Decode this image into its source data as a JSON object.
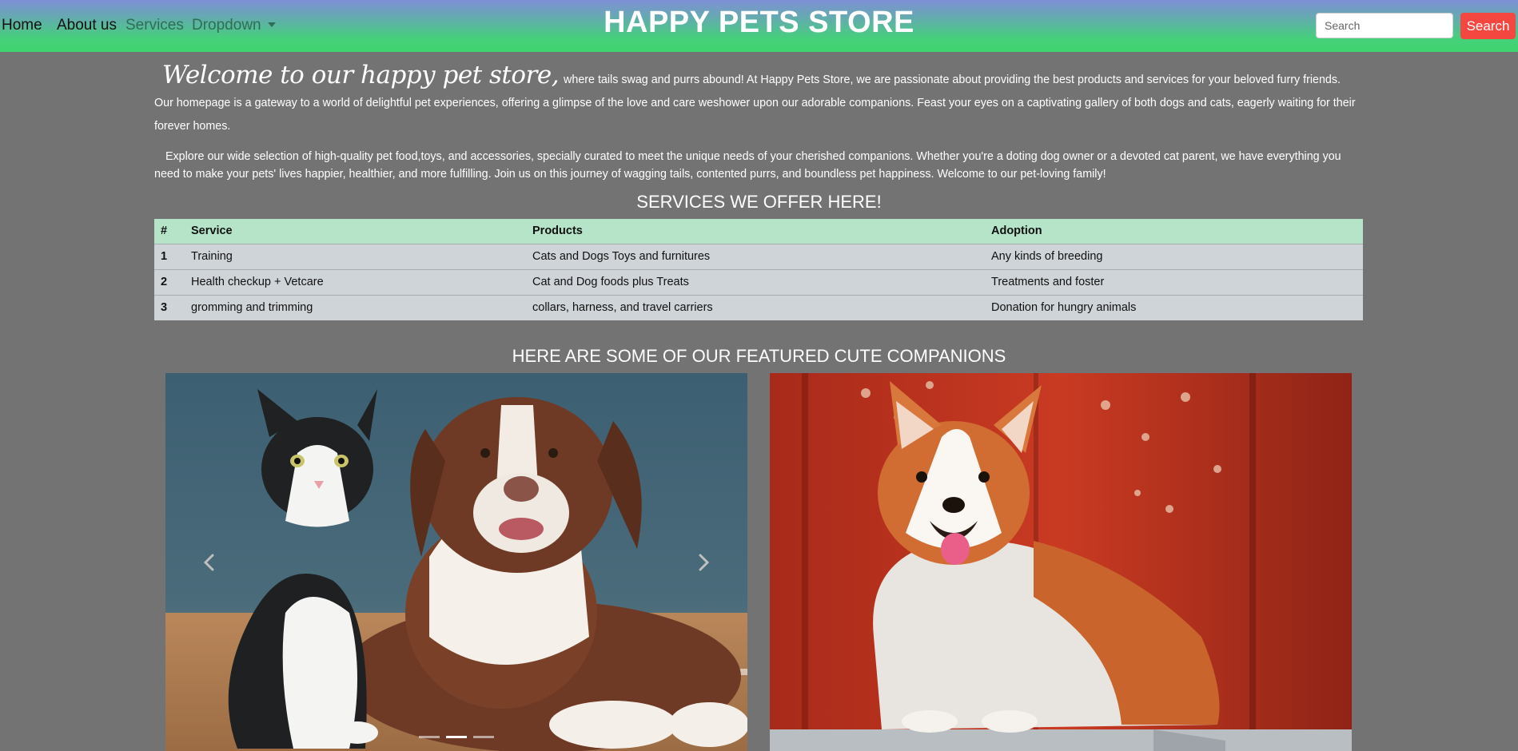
{
  "nav": {
    "home": "Home",
    "about": "About us",
    "services": "Services",
    "dropdown": "Dropdown",
    "brand": "HAPPY PETS STORE",
    "search_placeholder": "Search",
    "search_button": "Search"
  },
  "intro": {
    "welcome": "Welcome to our happy pet store,",
    "p1": "where tails swag and purrs abound! At Happy Pets Store, we are passionate about providing the best products and services for your beloved furry friends. Our homepage is a gateway to a world of delightful pet experiences, offering a glimpse of the love and care weshower upon our adorable companions. Feast your eyes on a captivating gallery of both dogs and cats, eagerly waiting for their forever homes.",
    "p2": "Explore our wide selection of high-quality pet food,toys, and accessories, specially curated to meet the unique needs of your cherished companions. Whether you're a doting dog owner or a devoted cat parent, we have everything you need to make your pets' lives happier, healthier, and more fulfilling. Join us on this journey of wagging tails, contented purrs, and boundless pet happiness. Welcome to our pet-loving family!"
  },
  "services": {
    "title": "SERVICES WE OFFER HERE!",
    "headers": [
      "#",
      "Service",
      "Products",
      "Adoption"
    ],
    "rows": [
      [
        "1",
        "Training",
        "Cats and Dogs Toys and furnitures",
        "Any kinds of breeding"
      ],
      [
        "2",
        "Health checkup + Vetcare",
        "Cat and Dog foods plus Treats",
        "Treatments and foster"
      ],
      [
        "3",
        "gromming and trimming",
        "collars, harness, and travel carriers",
        "Donation for hungry animals"
      ]
    ]
  },
  "featured": {
    "title": "HERE ARE SOME OF OUR FEATURED CUTE COMPANIONS",
    "carousel_active_slide": 2,
    "carousel_slide_count": 3
  },
  "colors": {
    "search_button": "#f4473f",
    "table_header": "#b5e4c8",
    "table_body": "#cfd4d8",
    "page_background": "#737373"
  },
  "icons": {
    "prev": "chevron-left-icon",
    "next": "chevron-right-icon",
    "dropdown": "caret-down-icon"
  }
}
